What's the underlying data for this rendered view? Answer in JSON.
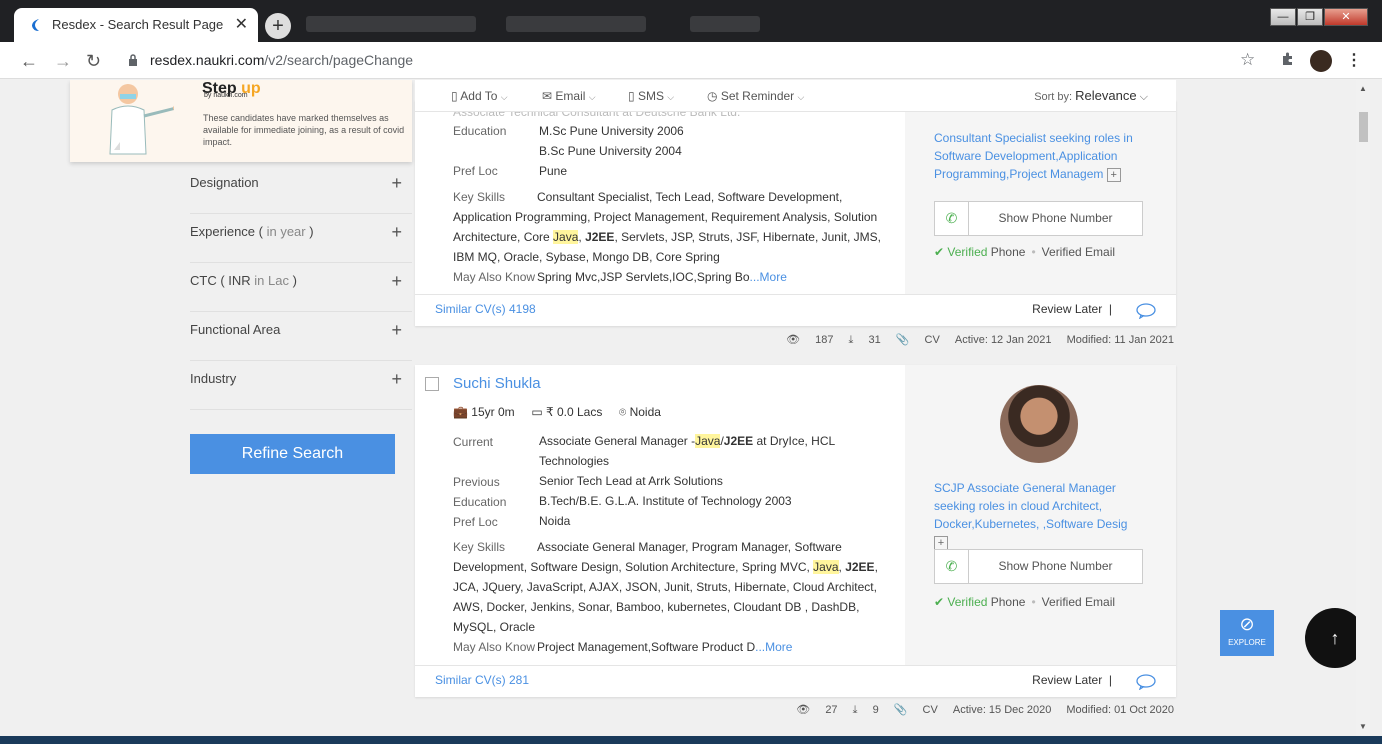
{
  "browser": {
    "tab_title": "Resdex - Search Result Page",
    "tab_close": "✕",
    "new_tab": "+",
    "url_host": "resdex.naukri.com",
    "url_path": "/v2/search/pageChange",
    "back": "←",
    "forward": "→",
    "reload": "↻",
    "star": "☆",
    "menu": "⋮"
  },
  "promo": {
    "logo_pre": "Step ",
    "logo_o": "up",
    "sub": "by naukri.com",
    "text": "These candidates have marked themselves as available for immediate joining, as a result of covid impact."
  },
  "filters": {
    "items": [
      {
        "label": "Designation",
        "unit": ""
      },
      {
        "label": "Experience (",
        "unit": " in year ",
        "close": ")"
      },
      {
        "label": "CTC ( INR",
        "unit": " in Lac ",
        "close": ")"
      },
      {
        "label": "Functional Area",
        "unit": ""
      },
      {
        "label": "Industry",
        "unit": ""
      }
    ],
    "plus": "+",
    "refine": "Refine Search"
  },
  "toolbar": {
    "add_to": "Add To",
    "email": "Email",
    "sms": "SMS",
    "reminder": "Set Reminder",
    "sort_label": "Sort by:",
    "sort_value": "Relevance",
    "caret": "⌵"
  },
  "cand1": {
    "cut_text": "Associate Technical Consultant at Deutsche Bank Ltd.",
    "education_label": "Education",
    "education": [
      "M.Sc Pune University 2006",
      "B.Sc Pune University 2004"
    ],
    "prefloc_label": "Pref Loc",
    "prefloc": "Pune",
    "keyskills_label": "Key Skills",
    "ks_a": "Consultant Specialist, Tech Lead, Software Development, Application Programming, Project Management, Requirement Analysis, Solution Architecture, Core ",
    "ks_java": "Java",
    "ks_b": ", ",
    "ks_j2ee": "J2EE",
    "ks_c": ", Servlets, JSP, Struts, JSF, Hibernate, Junit, JMS, IBM MQ, Oracle, Sybase, Mongo DB, Core Spring",
    "mayknow_label": "May Also Know",
    "mayknow": "Spring Mvc,JSP Servlets,IOC,Spring Bo",
    "more": "...More",
    "headline": "Consultant Specialist seeking roles in Software Development,Application Programming,Project Managem",
    "phone": "Show Phone Number",
    "verified_phone_a": "Verified",
    "verified_phone_b": " Phone",
    "verified_email": "Verified Email",
    "similar": "Similar CV(s) 4198",
    "review": "Review Later",
    "views": "187",
    "downloads": "31",
    "cv": "CV",
    "active": "Active: 12 Jan 2021",
    "modified": "Modified: 11 Jan 2021"
  },
  "cand2": {
    "name": "Suchi Shukla",
    "exp": "15yr 0m",
    "ctc": "₹ 0.0 Lacs",
    "loc": "Noida",
    "current_label": "Current",
    "current_a": "Associate General Manager -",
    "current_java": "Java",
    "current_slash": "/",
    "current_j2ee": "J2EE",
    "current_b": " at DryIce, HCL Technologies",
    "previous_label": "Previous",
    "previous": "Senior Tech Lead at Arrk Solutions",
    "education_label": "Education",
    "education": "B.Tech/B.E. G.L.A. Institute of Technology 2003",
    "prefloc_label": "Pref Loc",
    "prefloc": "Noida",
    "keyskills_label": "Key Skills",
    "ks_a": "Associate General Manager, Program Manager, Software Development, Software Design, Solution Architecture, Spring MVC, ",
    "ks_java": "Java",
    "ks_b": ", ",
    "ks_j2ee": "J2EE",
    "ks_c": ", JCA, JQuery, JavaScript, AJAX, JSON, Junit, Struts, Hibernate, Cloud Architect, AWS, Docker, Jenkins, Sonar, Bamboo, kubernetes, Cloudant DB , DashDB, MySQL, Oracle",
    "mayknow_label": "May Also Know",
    "mayknow": "Project Management,Software Product D",
    "more": "...More",
    "headline": "SCJP Associate General Manager seeking roles in cloud Architect, Docker,Kubernetes, ,Software Desig",
    "phone": "Show Phone Number",
    "verified_phone_a": "Verified",
    "verified_phone_b": " Phone",
    "verified_email": "Verified Email",
    "similar": "Similar CV(s) 281",
    "review": "Review Later",
    "views": "27",
    "downloads": "9",
    "cv": "CV",
    "active": "Active: 15 Dec 2020",
    "modified": "Modified: 01 Oct 2020"
  },
  "explore": "EXPLORE",
  "to_top": "↑"
}
